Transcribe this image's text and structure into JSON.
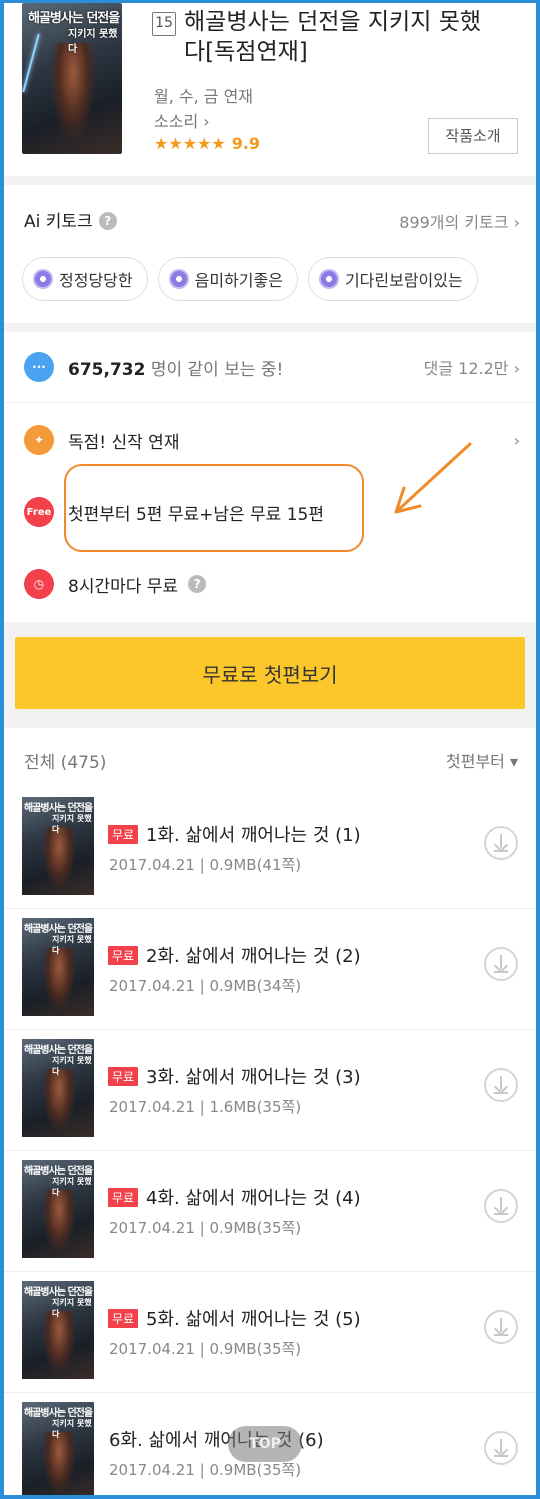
{
  "header": {
    "cover_title_line1": "해골병사는 던전을",
    "cover_title_line2": "지키지 못했다",
    "age_badge": "15",
    "title": "해골병사는 던전을 지키지 못했다[독점연재]",
    "schedule": "월, 수, 금 연재",
    "author": "소소리",
    "stars": "★★★★★",
    "rating": "9.9",
    "intro_button": "작품소개"
  },
  "talk": {
    "title": "Ai 키토크",
    "count": "899개의 키토크",
    "chips": [
      "정정당당한",
      "음미하기좋은",
      "기다린보람이있는"
    ]
  },
  "info": {
    "viewers_count": "675,732",
    "viewers_text": "명이 같이 보는 중!",
    "comments": "댓글 12.2만",
    "exclusive": "독점! 신작 연재",
    "free_badge": "Free",
    "free_offer": "첫편부터 5편 무료+남은 무료 15편",
    "timer_free": "8시간마다 무료"
  },
  "cta": {
    "label": "무료로 첫편보기"
  },
  "list": {
    "total": "전체 (475)",
    "sort": "첫편부터 ▾",
    "free_tag": "무료",
    "episodes": [
      {
        "title": "1화. 삶에서 깨어나는 것 (1)",
        "date": "2017.04.21",
        "size": "0.9MB(41쪽)",
        "free": true
      },
      {
        "title": "2화. 삶에서 깨어나는 것 (2)",
        "date": "2017.04.21",
        "size": "0.9MB(34쪽)",
        "free": true
      },
      {
        "title": "3화. 삶에서 깨어나는 것 (3)",
        "date": "2017.04.21",
        "size": "1.6MB(35쪽)",
        "free": true
      },
      {
        "title": "4화. 삶에서 깨어나는 것 (4)",
        "date": "2017.04.21",
        "size": "0.9MB(35쪽)",
        "free": true
      },
      {
        "title": "5화. 삶에서 깨어나는 것 (5)",
        "date": "2017.04.21",
        "size": "0.9MB(35쪽)",
        "free": true
      },
      {
        "title": "6화. 삶에서 깨어나는 것 (6)",
        "date": "2017.04.21",
        "size": "0.9MB(35쪽)",
        "free": false
      }
    ]
  },
  "top_button": "TOP",
  "colors": {
    "accent": "#fcc72a",
    "free_red": "#f2414a",
    "rating_orange": "#f39a1c",
    "highlight": "#f08a2a",
    "frame_blue": "#2a8fd8"
  }
}
